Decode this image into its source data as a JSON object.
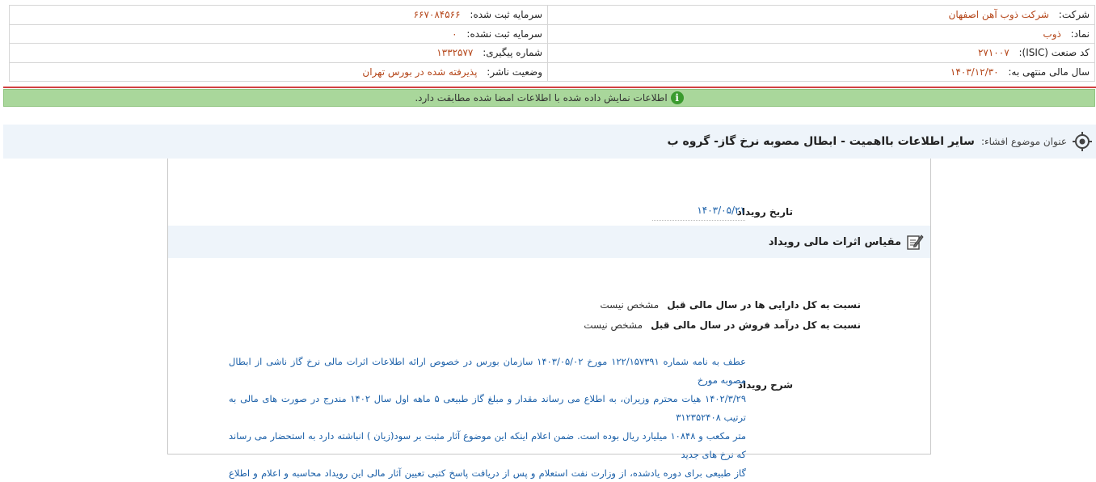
{
  "company": {
    "company_label": "شرکت:",
    "company_value": "شرکت ذوب آهن اصفهان",
    "registered_capital_label": "سرمایه ثبت شده:",
    "registered_capital_value": "۶۶۷۰۸۴۵۶۶",
    "symbol_label": "نماد:",
    "symbol_value": "ذوب",
    "unregistered_capital_label": "سرمایه ثبت نشده:",
    "unregistered_capital_value": "۰",
    "isic_label": "کد صنعت (ISIC):",
    "isic_value": "۲۷۱۰۰۷",
    "tracking_label": "شماره پیگیری:",
    "tracking_value": "۱۳۳۲۵۷۷",
    "fiscal_year_label": "سال مالی منتهی به:",
    "fiscal_year_value": "۱۴۰۳/۱۲/۳۰",
    "publisher_status_label": "وضعیت ناشر:",
    "publisher_status_value": "پذیرفته شده در بورس تهران"
  },
  "notice": {
    "text": "اطلاعات نمایش داده شده با اطلاعات امضا شده مطابقت دارد.",
    "icon": "info-icon",
    "color": "#a9d79b"
  },
  "subject": {
    "label": "عنوان موضوع افشاء:",
    "title": "سایر اطلاعات بااهمیت - ابطال مصوبه نرخ گاز- گروه ب",
    "icon": "target-icon"
  },
  "event": {
    "date_label": "تاریخ رویداد",
    "date_value": "۱۴۰۳/۰۵/۲۱"
  },
  "financial_effects": {
    "title": "مقیاس اثرات مالی رویداد",
    "icon": "pencil-icon",
    "rows": [
      {
        "label": "نسبت به کل دارایی ها در سال مالی قبل",
        "value": "مشخص نیست"
      },
      {
        "label": "نسبت به کل درآمد فروش در سال مالی قبل",
        "value": "مشخص نیست"
      }
    ]
  },
  "description": {
    "label": "شرح رویداد",
    "lines": [
      "عطف به نامه شماره ۱۲۲/۱۵۷۳۹۱ مورخ ۱۴۰۳/۰۵/۰۲ سازمان بورس در خصوص ارائه اطلاعات اثرات مالی نرخ گاز ناشی از ابطال مصوبه مورخ",
      "۱۴۰۲/۳/۲۹ هیات محترم وزیران، به اطلاع می رساند مقدار و مبلغ گاز طبیعی ۵ ماهه اول سال ۱۴۰۲ مندرج در صورت های مالی به ترتیب ۳۱۲۳۵۲۴۰۸",
      "متر مکعب و ۱۰۸۴۸ میلیارد ریال بوده است. ضمن اعلام اینکه این موضوع آثار مثبت بر سود(زیان ) انباشته دارد به استحضار می رساند که نرخ های جدید",
      "گاز طبیعی برای دوره یادشده، از وزارت نفت استعلام و پس از دریافت پاسخ کتبی تعیین آثار مالی این رویداد محاسبه و اعلام و اطلاع رسانی خواهد شد."
    ]
  },
  "colors": {
    "accent_value": "#b5471b",
    "link_blue": "#1a5fa8",
    "header_band": "#eef4fa",
    "divider_red": "#d24141"
  }
}
